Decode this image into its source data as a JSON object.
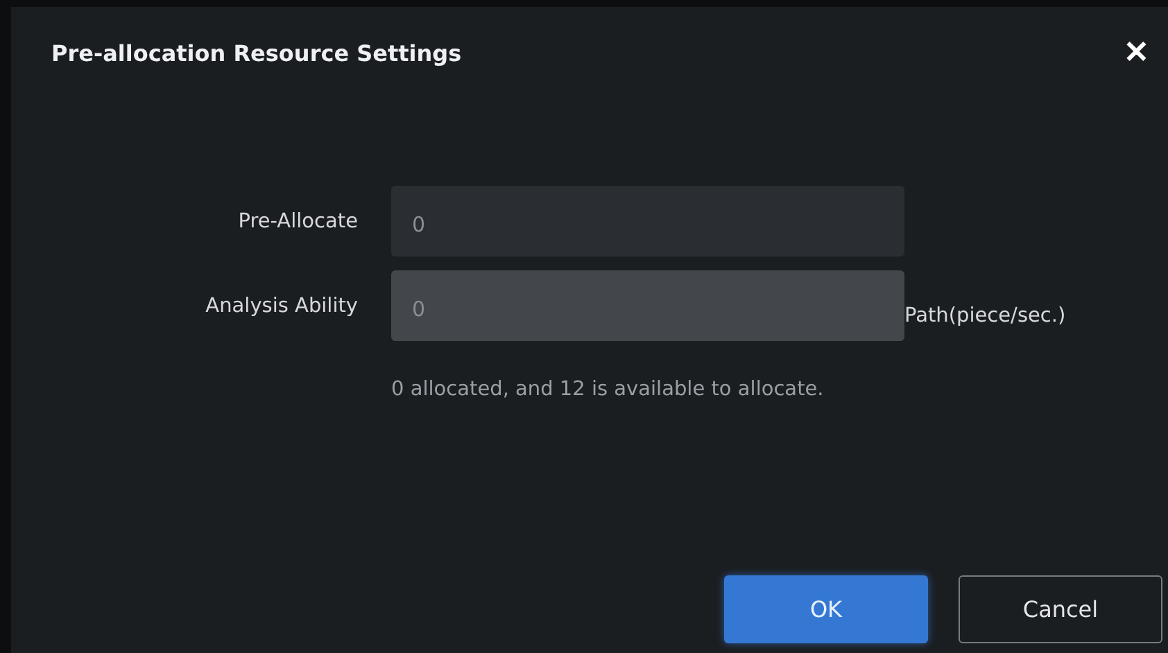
{
  "dialog": {
    "title": "Pre-allocation Resource Settings",
    "close": "✕"
  },
  "fields": [
    {
      "label": "Pre-Allocate",
      "value": "0",
      "focused": false
    },
    {
      "label": "Analysis Ability",
      "value": "0",
      "focused": true,
      "unit": "Path(piece/sec.)"
    }
  ],
  "hint": "0 allocated, and 12 is available to allocate.",
  "buttons": [
    {
      "label": "OK",
      "kind": "primary"
    },
    {
      "label": "Cancel",
      "kind": "secondary"
    }
  ]
}
